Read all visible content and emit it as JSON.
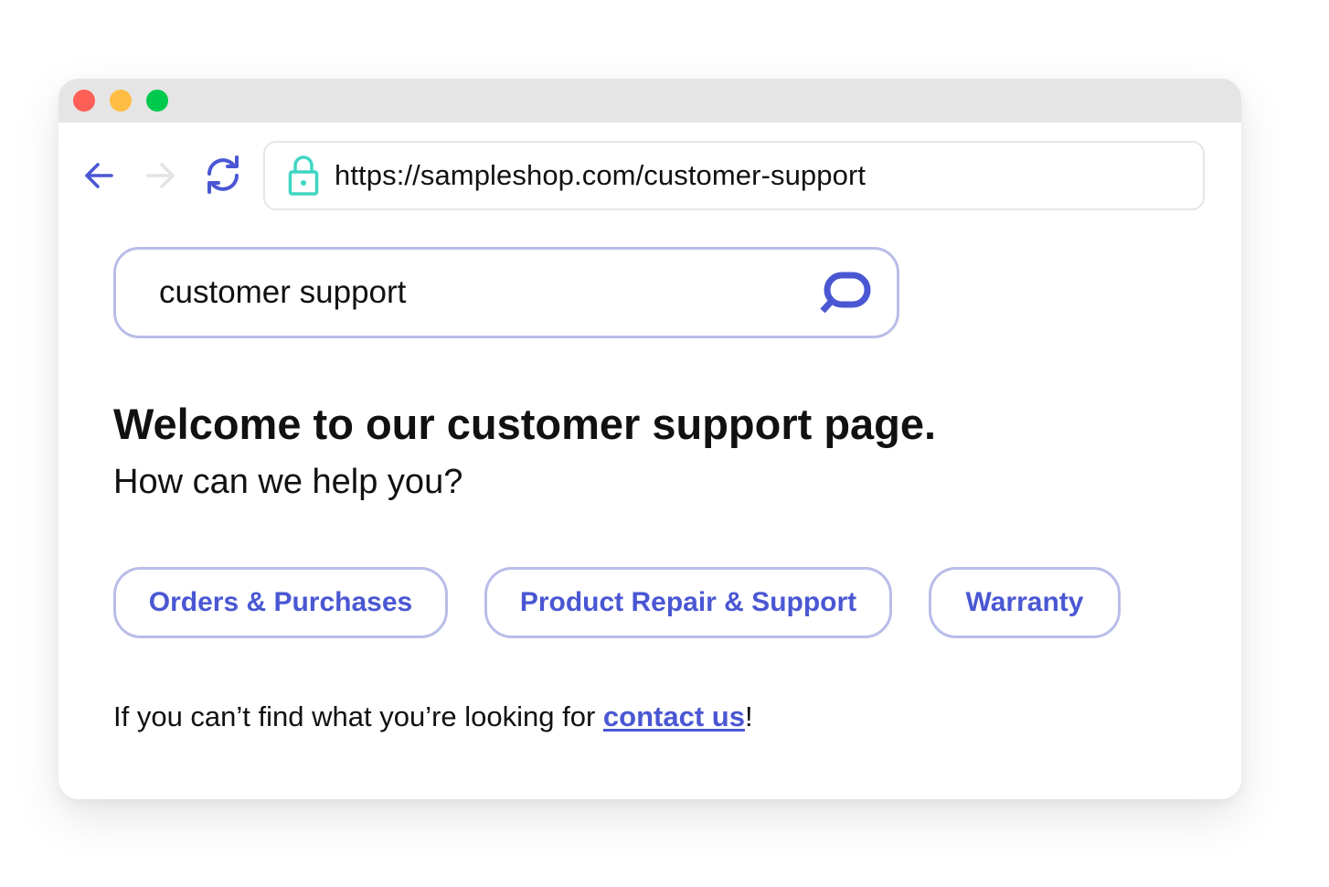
{
  "window": {
    "controls": [
      "close",
      "minimize",
      "maximize"
    ],
    "colors": {
      "close": "#ff5f57",
      "minimize": "#ffbd44",
      "maximize": "#00ca4e"
    }
  },
  "browser": {
    "back_icon": "arrow-left-icon",
    "forward_icon": "arrow-right-icon",
    "reload_icon": "refresh-icon",
    "lock_icon": "lock-icon",
    "url": "https://sampleshop.com/customer-support"
  },
  "search": {
    "value": "customer support",
    "icon": "search-icon"
  },
  "main": {
    "heading": "Welcome to our customer support page.",
    "subheading": "How can we help you?",
    "topics": [
      {
        "label": "Orders & Purchases"
      },
      {
        "label": "Product Repair & Support"
      },
      {
        "label": "Warranty"
      }
    ],
    "footer": {
      "prefix": "If you can’t find what you’re looking for ",
      "link_label": "contact us",
      "suffix": "!"
    }
  },
  "colors": {
    "accent": "#4a57d3",
    "border_accent": "#b9bde9",
    "lock": "#3fd6c3",
    "disabled": "#e0e0e0"
  }
}
